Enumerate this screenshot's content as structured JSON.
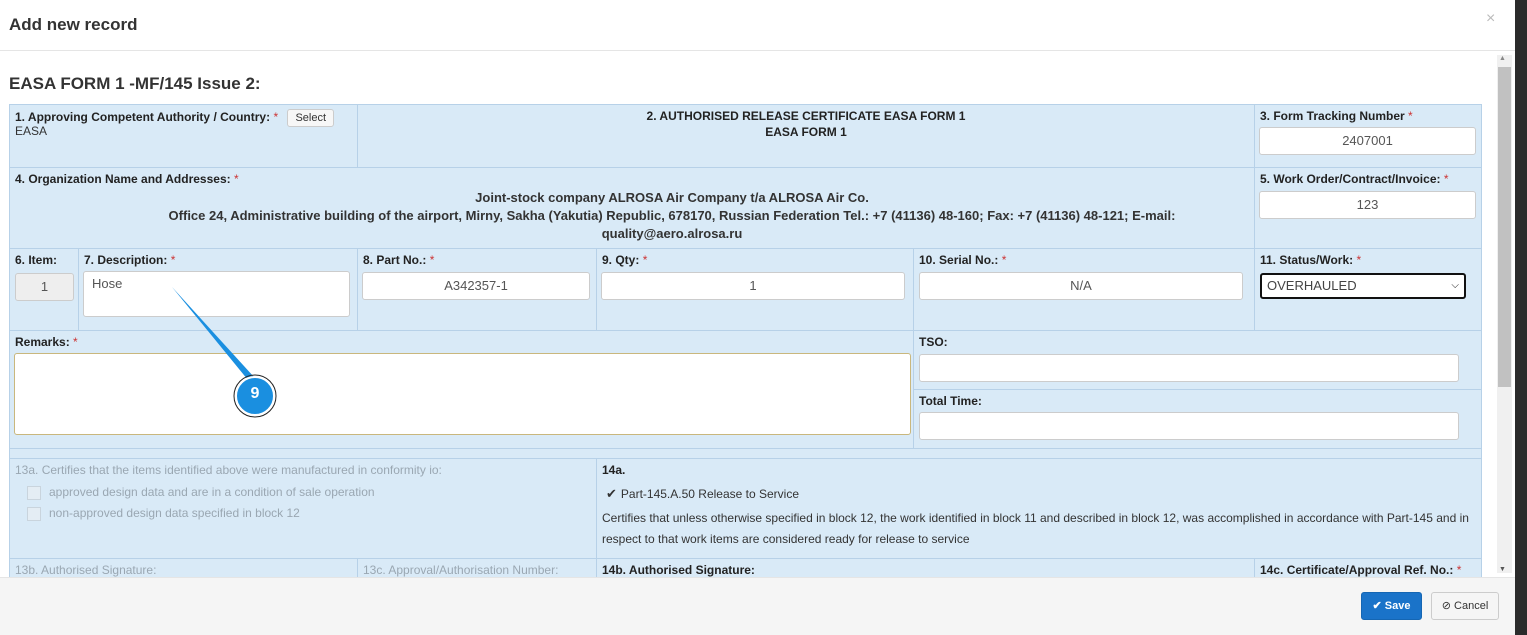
{
  "modal": {
    "title": "Add new record",
    "close": "×"
  },
  "form_title": "EASA FORM 1 -MF/145 Issue 2:",
  "block1": {
    "label": "1. Approving Competent Authority / Country:",
    "value": "EASA",
    "select_button": "Select"
  },
  "block2": {
    "title": "2. AUTHORISED RELEASE CERTIFICATE EASA FORM 1",
    "subtitle": "EASA FORM 1"
  },
  "block3": {
    "label": "3. Form Tracking Number",
    "value": "2407001"
  },
  "block4": {
    "label": "4. Organization Name and Addresses:",
    "line1": "Joint-stock company ALROSA Air Company t/a ALROSA Air Co.",
    "line2": "Office 24, Administrative building of the airport, Mirny, Sakha (Yakutia) Republic, 678170, Russian Federation Tel.: +7 (41136) 48-160; Fax: +7 (41136) 48-121; E-mail:",
    "line3": "quality@aero.alrosa.ru"
  },
  "block5": {
    "label": "5. Work Order/Contract/Invoice:",
    "value": "123"
  },
  "block6": {
    "label": "6. Item:",
    "value": "1"
  },
  "block7": {
    "label": "7. Description:",
    "value": "Hose"
  },
  "block8": {
    "label": "8. Part No.:",
    "value": "A342357-1"
  },
  "block9": {
    "label": "9. Qty:",
    "value": "1"
  },
  "block10": {
    "label": "10. Serial No.:",
    "value": "N/A"
  },
  "block11": {
    "label": "11. Status/Work:",
    "value": "OVERHAULED"
  },
  "remarks": {
    "label": "Remarks:",
    "value": ""
  },
  "tso": {
    "label": "TSO:",
    "value": ""
  },
  "total_time": {
    "label": "Total Time:",
    "value": ""
  },
  "block13a": {
    "label": "13a. Certifies that the items identified above were manufactured in conformity io:",
    "opt1": "approved design data and are in a condition of sale operation",
    "opt2": "non-approved design data specified in block 12"
  },
  "block14a": {
    "label": "14a.",
    "checkbox": "Part-145.A.50 Release to Service",
    "checked": true,
    "text": "Certifies that unless otherwise specified in block 12, the work identified in block 11 and described in block 12, was accomplished in accordance with Part-145 and in respect to that work items are considered ready for release to service"
  },
  "block13b": {
    "label": "13b. Authorised Signature:"
  },
  "block13c": {
    "label": "13c. Approval/Authorisation Number:"
  },
  "block14b": {
    "label": "14b. Authorised Signature:"
  },
  "block14c": {
    "label": "14c. Certificate/Approval Ref. No.:"
  },
  "required_mark": "*",
  "annotation": {
    "number": "9"
  },
  "footer": {
    "save": "Save",
    "cancel": "Cancel"
  }
}
